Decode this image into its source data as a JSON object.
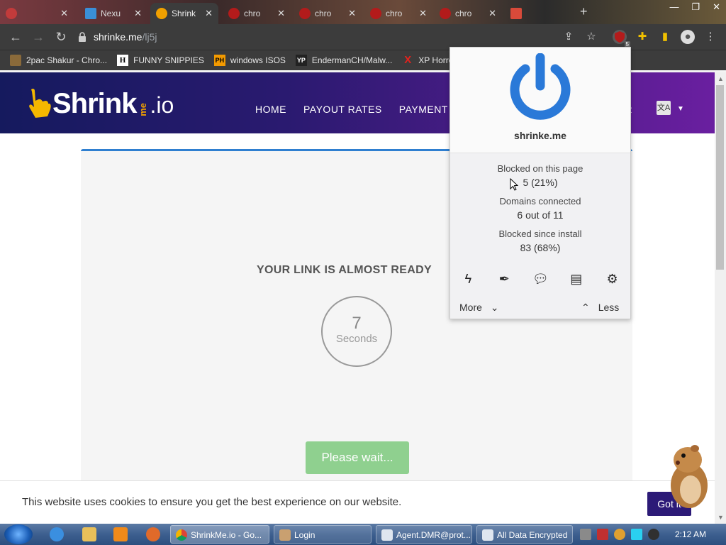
{
  "browser": {
    "tabs": [
      {
        "label": "",
        "fav": "#c23b3b"
      },
      {
        "label": "Nexu",
        "fav": "#3a8fd8"
      },
      {
        "label": "Shrink",
        "fav": "#f0a000",
        "active": true
      },
      {
        "label": "chro",
        "fav": "#b31b1b"
      },
      {
        "label": "chro",
        "fav": "#b31b1b"
      },
      {
        "label": "chro",
        "fav": "#b31b1b"
      },
      {
        "label": "chro",
        "fav": "#b31b1b"
      },
      {
        "label": "",
        "fav": "#d84a3a"
      }
    ],
    "new_tab": "+",
    "url_host": "shrinke.me",
    "url_path": "/lj5j",
    "extension_badge": "5",
    "bookmarks": [
      {
        "label": "2pac Shakur - Chro...",
        "icon": "folder-icon"
      },
      {
        "label": "FUNNY SNIPPIES",
        "icon": "H"
      },
      {
        "label": "windows ISOS",
        "icon": "PH"
      },
      {
        "label": "EndermanCH/Malw...",
        "icon": "YP"
      },
      {
        "label": "XP Horro",
        "icon": "X"
      }
    ]
  },
  "site": {
    "logo_main": "Shrink",
    "logo_me": "me",
    "logo_tail": ".io",
    "nav": [
      "HOME",
      "PAYOUT RATES",
      "PAYMENT P"
    ],
    "nav_tail": "ER",
    "heading": "YOUR LINK IS ALMOST READY",
    "timer_value": "7",
    "timer_unit": "Seconds",
    "wait_button": "Please wait...",
    "cookie_text": "This website uses cookies to ensure you get the best experience on our website.",
    "cookie_button": "Got it"
  },
  "popup": {
    "hostname": "shrinke.me",
    "blocked_page_label": "Blocked on this page",
    "blocked_page_value": "5 (21%)",
    "domains_label": "Domains connected",
    "domains_value": "6 out of 11",
    "blocked_install_label": "Blocked since install",
    "blocked_install_value": "83 (68%)",
    "more_label": "More",
    "less_label": "Less",
    "accent": "#2a79d8"
  },
  "taskbar": {
    "tasks": [
      {
        "label": "ShrinkMe.io - Go...",
        "icon": "chrome-icon"
      },
      {
        "label": "Login",
        "icon": "app-icon"
      },
      {
        "label": "Agent.DMR@prot...",
        "icon": "window-icon"
      },
      {
        "label": "All Data Encrypted",
        "icon": "window-icon"
      }
    ],
    "clock": "2:12 AM"
  }
}
